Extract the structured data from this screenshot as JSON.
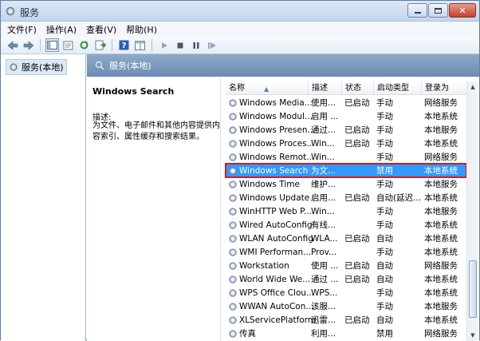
{
  "window": {
    "title": "服务"
  },
  "menu": [
    {
      "label": "文件(F)"
    },
    {
      "label": "操作(A)"
    },
    {
      "label": "查看(V)"
    },
    {
      "label": "帮助(H)"
    }
  ],
  "tree": {
    "node": "服务(本地)"
  },
  "main": {
    "header": "服务(本地)"
  },
  "detail": {
    "title": "Windows Search",
    "label": "描述:",
    "description": "为文件、电子邮件和其他内容提供内容索引、属性缓存和搜索结果。"
  },
  "columns": {
    "name": "名称",
    "desc": "描述",
    "status": "状态",
    "startup": "启动类型",
    "logon": "登录为"
  },
  "services": [
    {
      "name": "Windows Media...",
      "desc": "使用...",
      "status": "已启动",
      "startup": "手动",
      "logon": "网络服务"
    },
    {
      "name": "Windows Modul...",
      "desc": "启用 ...",
      "status": "",
      "startup": "手动",
      "logon": "本地系统"
    },
    {
      "name": "Windows Presen...",
      "desc": "通过...",
      "status": "已启动",
      "startup": "手动",
      "logon": "本地服务"
    },
    {
      "name": "Windows Proces...",
      "desc": "Win...",
      "status": "已启动",
      "startup": "手动",
      "logon": "本地系统"
    },
    {
      "name": "Windows Remot...",
      "desc": "Win...",
      "status": "",
      "startup": "手动",
      "logon": "网络服务"
    },
    {
      "name": "Windows Search",
      "desc": "为文...",
      "status": "",
      "startup": "禁用",
      "logon": "本地系统",
      "selected": true
    },
    {
      "name": "Windows Time",
      "desc": "维护...",
      "status": "",
      "startup": "手动",
      "logon": "本地服务"
    },
    {
      "name": "Windows Update",
      "desc": "启用...",
      "status": "已启动",
      "startup": "自动(延迟...",
      "logon": "本地系统"
    },
    {
      "name": "WinHTTP Web P...",
      "desc": "Win...",
      "status": "",
      "startup": "手动",
      "logon": "本地服务"
    },
    {
      "name": "Wired AutoConfig",
      "desc": "有线...",
      "status": "",
      "startup": "手动",
      "logon": "本地系统"
    },
    {
      "name": "WLAN AutoConfig",
      "desc": "WLA...",
      "status": "已启动",
      "startup": "自动",
      "logon": "本地系统"
    },
    {
      "name": "WMI Performan...",
      "desc": "Prov...",
      "status": "",
      "startup": "手动",
      "logon": "本地系统"
    },
    {
      "name": "Workstation",
      "desc": "使用 ...",
      "status": "已启动",
      "startup": "自动",
      "logon": "网络服务"
    },
    {
      "name": "World Wide We...",
      "desc": "通过 ...",
      "status": "已启动",
      "startup": "自动",
      "logon": "本地系统"
    },
    {
      "name": "WPS Office Clou...",
      "desc": "WPS...",
      "status": "",
      "startup": "手动",
      "logon": "本地系统"
    },
    {
      "name": "WWAN AutoCon...",
      "desc": "该服...",
      "status": "",
      "startup": "手动",
      "logon": "本地服务"
    },
    {
      "name": "XLServicePlatform",
      "desc": "迅雷...",
      "status": "已启动",
      "startup": "自动",
      "logon": "本地系统"
    },
    {
      "name": "传真",
      "desc": "利用...",
      "status": "",
      "startup": "禁用",
      "logon": "网络服务"
    }
  ],
  "icons": {
    "title": "gear-icon",
    "service": "gear-icon",
    "back": "back-arrow-icon",
    "forward": "forward-arrow-icon",
    "play": "play-icon",
    "stop": "stop-icon",
    "pause": "pause-icon",
    "restart": "restart-icon"
  },
  "colors": {
    "selected_row": "#3399ff",
    "highlight_border": "#d21d1d",
    "header_bar": "#7b98bd"
  }
}
